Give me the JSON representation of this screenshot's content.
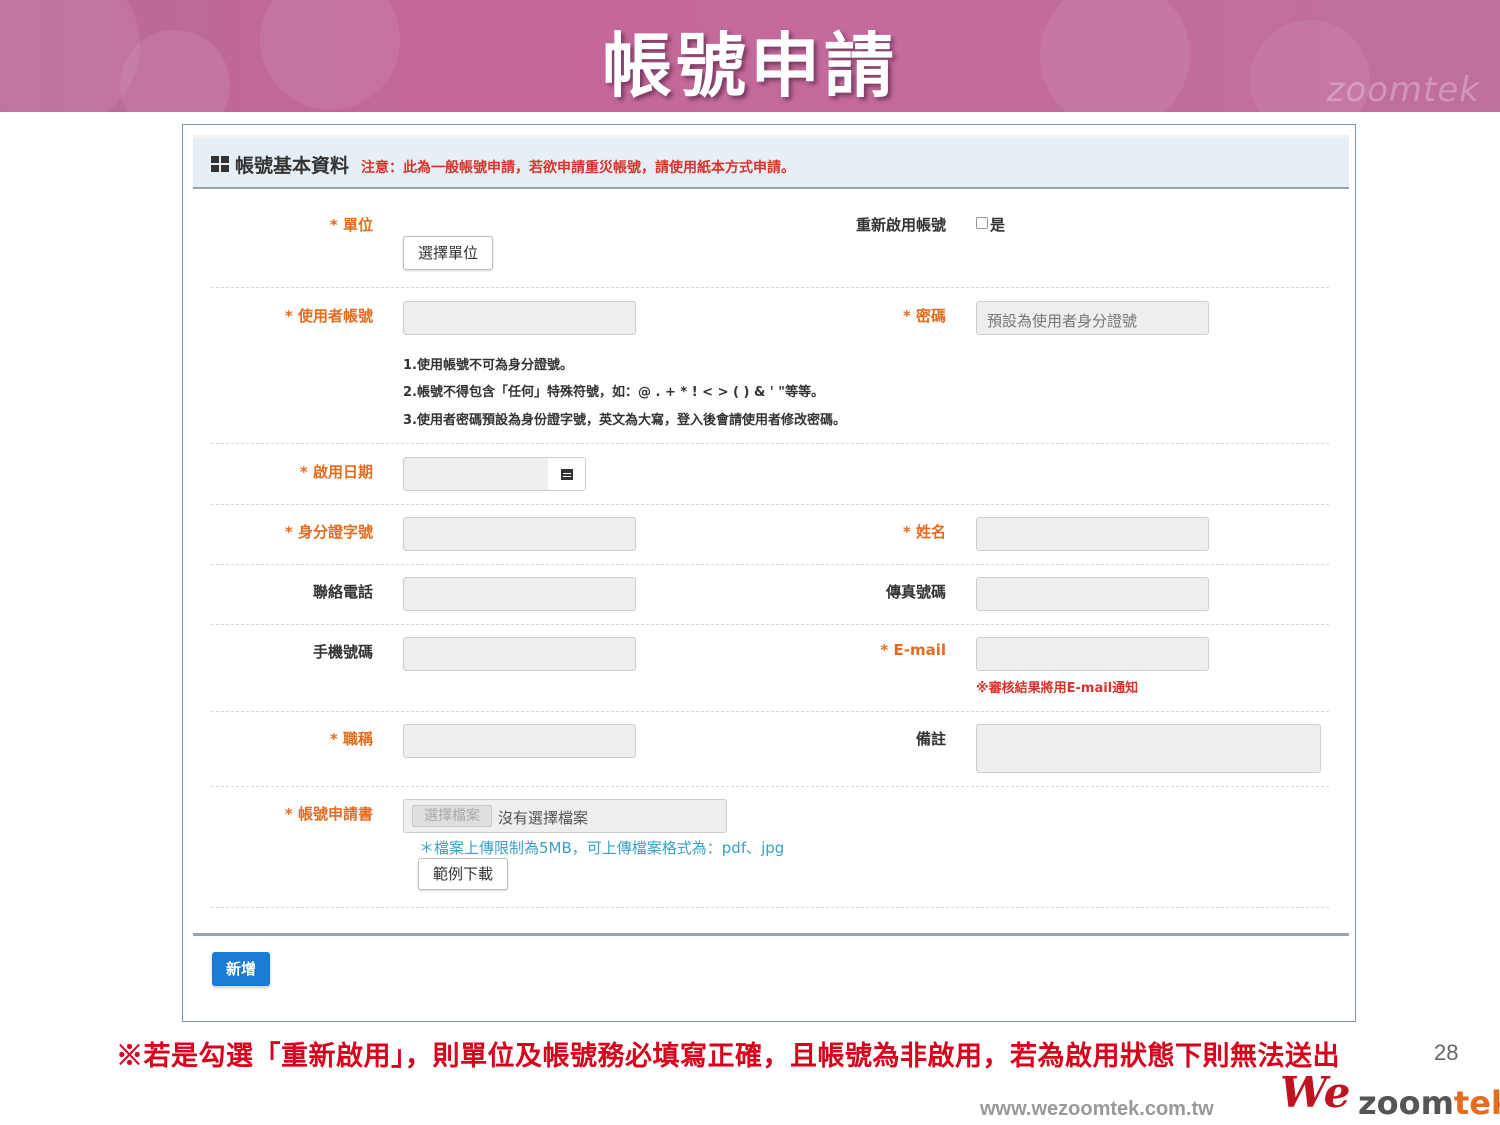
{
  "slide": {
    "title": "帳號申請",
    "watermark": "zoomtek",
    "warning": "※若是勾選「重新啟用」，則單位及帳號務必填寫正確，且帳號為非啟用，若為啟用狀態下則無法送出",
    "page_number": "28",
    "url": "www.wezoomtek.com.tw",
    "brand": {
      "we": "We",
      "zoom": "zoom",
      "tek": "tek"
    }
  },
  "panel": {
    "title": "帳號基本資料",
    "notice": "注意：此為一般帳號申請，若欲申請重災帳號，請使用紙本方式申請。"
  },
  "form": {
    "unit": {
      "label": "* 單位",
      "button": "選擇單位"
    },
    "reactivate": {
      "label": "重新啟用帳號",
      "option": "是",
      "checked": false
    },
    "username": {
      "label": "* 使用者帳號",
      "value": ""
    },
    "password": {
      "label": "* 密碼",
      "placeholder": "預設為使用者身分證號"
    },
    "hints": [
      "1.使用帳號不可為身分證號。",
      "2.帳號不得包含「任何」特殊符號，如：@ . + * ! < > ( ) & ' \"等等。",
      "3.使用者密碼預設為身份證字號，英文為大寫，登入後會請使用者修改密碼。"
    ],
    "start_date": {
      "label": "* 啟用日期",
      "value": ""
    },
    "id_number": {
      "label": "* 身分證字號",
      "value": ""
    },
    "name": {
      "label": "* 姓名",
      "value": ""
    },
    "phone": {
      "label": "聯絡電話",
      "value": ""
    },
    "fax": {
      "label": "傳真號碼",
      "value": ""
    },
    "mobile": {
      "label": "手機號碼",
      "value": ""
    },
    "email": {
      "label": "* E-mail",
      "value": "",
      "note": "※審核結果將用E-mail通知"
    },
    "job_title": {
      "label": "* 職稱",
      "value": ""
    },
    "remarks": {
      "label": "備註",
      "value": ""
    },
    "application_form": {
      "label": "* 帳號申請書",
      "choose_button": "選擇檔案",
      "file_status": "沒有選擇檔案",
      "upload_note": "＊檔案上傳限制為5MB，可上傳檔案格式為：pdf、jpg",
      "sample_button": "範例下載"
    },
    "submit_label": "新增"
  },
  "colors": {
    "required_label": "#e56b1f",
    "notice": "#d9342b",
    "primary_button": "#1a7bd4",
    "upload_note": "#3aa0c8"
  }
}
